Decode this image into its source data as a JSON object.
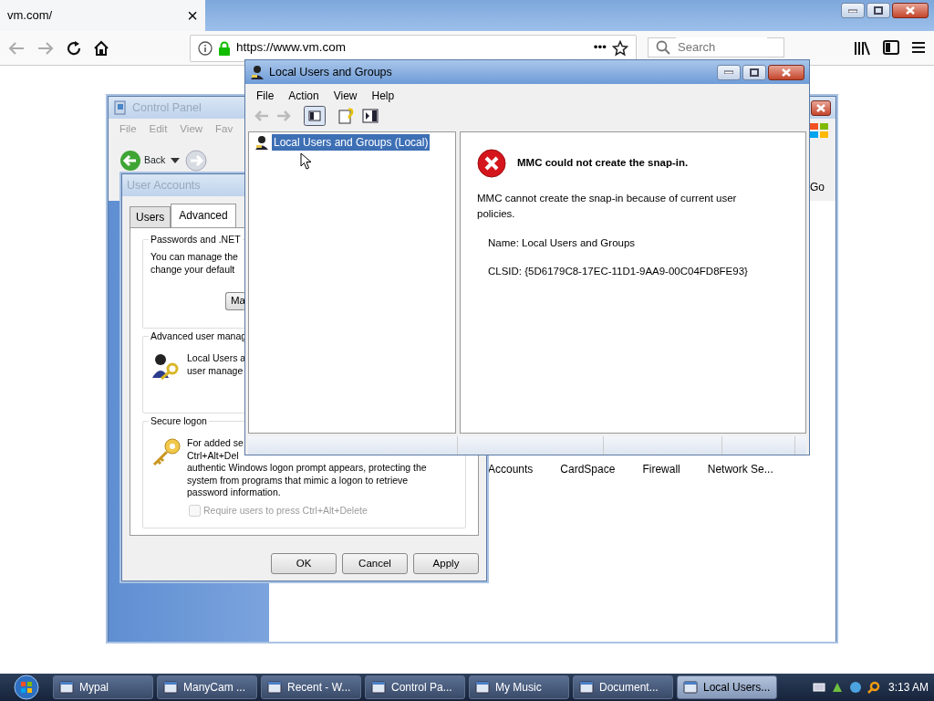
{
  "browser": {
    "tab": {
      "title": "vm.com/",
      "close": "×"
    },
    "url": "https://www.vm.com",
    "page_actions": "•••",
    "search": {
      "placeholder": "Search"
    }
  },
  "control_panel": {
    "title": "Control Panel",
    "active": false,
    "menu": [
      "File",
      "Edit",
      "View",
      "Fav"
    ],
    "back": "Back",
    "go": "Go",
    "items": [
      "Accounts",
      "CardSpace",
      "Firewall",
      "Network Se..."
    ]
  },
  "user_accounts": {
    "title": "User Accounts",
    "active": false,
    "tabs": [
      {
        "label": "Users",
        "selected": false
      },
      {
        "label": "Advanced",
        "selected": true
      }
    ],
    "groups": [
      {
        "kind": "button",
        "title": "Passwords and .NET",
        "lines": [
          "You can manage the",
          "change your default"
        ],
        "button": "Ma"
      },
      {
        "kind": "users",
        "title": "Advanced user manag",
        "lines": [
          "Local Users a",
          "user manage"
        ]
      },
      {
        "kind": "key",
        "title": "Secure logon",
        "lines": [
          "For added se",
          "Ctrl+Alt+Del",
          "authentic Windows logon prompt appears, protecting the",
          "system from programs that mimic a logon to retrieve",
          "password information."
        ],
        "checkbox": {
          "label": "Require users to press Ctrl+Alt+Delete",
          "checked": false,
          "disabled": true
        }
      }
    ],
    "buttons": [
      "OK",
      "Cancel",
      "Apply"
    ]
  },
  "mmc": {
    "title": "Local Users and Groups",
    "active": true,
    "menu": [
      "File",
      "Action",
      "View",
      "Help"
    ],
    "tree": [
      {
        "label": "Local Users and Groups (Local)",
        "selected": true
      }
    ],
    "error": {
      "title": "MMC could not create the snap-in.",
      "message": "MMC cannot create the snap-in because of current user policies.",
      "name": "Name: Local Users and Groups",
      "clsid": "CLSID: {5D6179C8-17EC-11D1-9AA9-00C04FD8FE93}"
    }
  },
  "taskbar": {
    "items": [
      {
        "label": "Mypal",
        "selected": false
      },
      {
        "label": "ManyCam ...",
        "selected": false
      },
      {
        "label": "Recent - W...",
        "selected": false
      },
      {
        "label": "Control Pa...",
        "selected": false
      },
      {
        "label": "My Music",
        "selected": false
      },
      {
        "label": "Document...",
        "selected": false
      },
      {
        "label": "Local Users...",
        "selected": true
      }
    ],
    "clock": "3:13 AM"
  }
}
